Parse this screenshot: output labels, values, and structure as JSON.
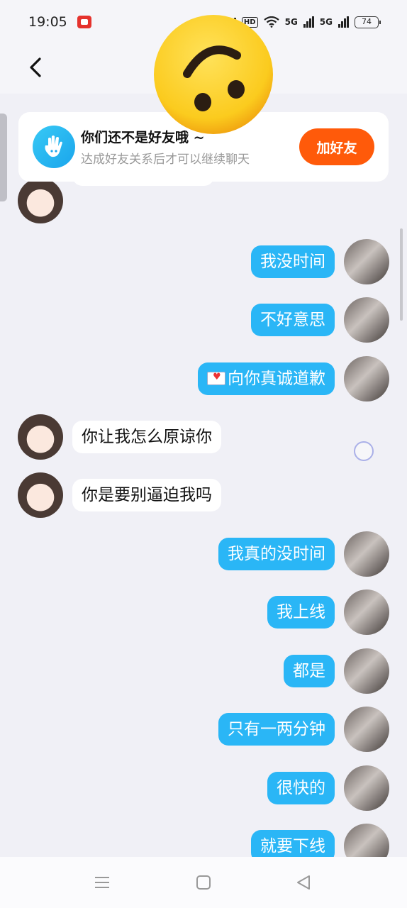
{
  "status_bar": {
    "time": "19:05",
    "hd_badge": "HD",
    "net_1": "5G",
    "net_2": "5G",
    "battery": "74"
  },
  "friend_banner": {
    "title": "你们还不是好友哦 ~",
    "subtitle": "达成好友关系后才可以继续聊天",
    "add_button": "加好友",
    "accent": "#ff5a0a"
  },
  "colors": {
    "sent_bubble": "#2ab6f6",
    "received_bubble": "#ffffff",
    "background": "#f0f0f6"
  },
  "messages": [
    {
      "from": "them",
      "text": ""
    },
    {
      "from": "me",
      "text": "我没时间"
    },
    {
      "from": "me",
      "text": "不好意思"
    },
    {
      "from": "me",
      "text": "向你真诚道歉",
      "icon": "envelope-heart-icon"
    },
    {
      "from": "them",
      "text": "你让我怎么原谅你"
    },
    {
      "from": "them",
      "text": "你是要别逼迫我吗"
    },
    {
      "from": "me",
      "text": "我真的没时间"
    },
    {
      "from": "me",
      "text": "我上线"
    },
    {
      "from": "me",
      "text": "都是"
    },
    {
      "from": "me",
      "text": "只有一两分钟"
    },
    {
      "from": "me",
      "text": "很快的"
    },
    {
      "from": "me",
      "text": "就要下线"
    }
  ],
  "icons": {
    "back": "chevron-left-icon",
    "overlay": "upside-down-face-emoji",
    "banner": "waving-hand-icon",
    "nav": [
      "menu-icon",
      "home-square-icon",
      "back-triangle-icon"
    ]
  }
}
